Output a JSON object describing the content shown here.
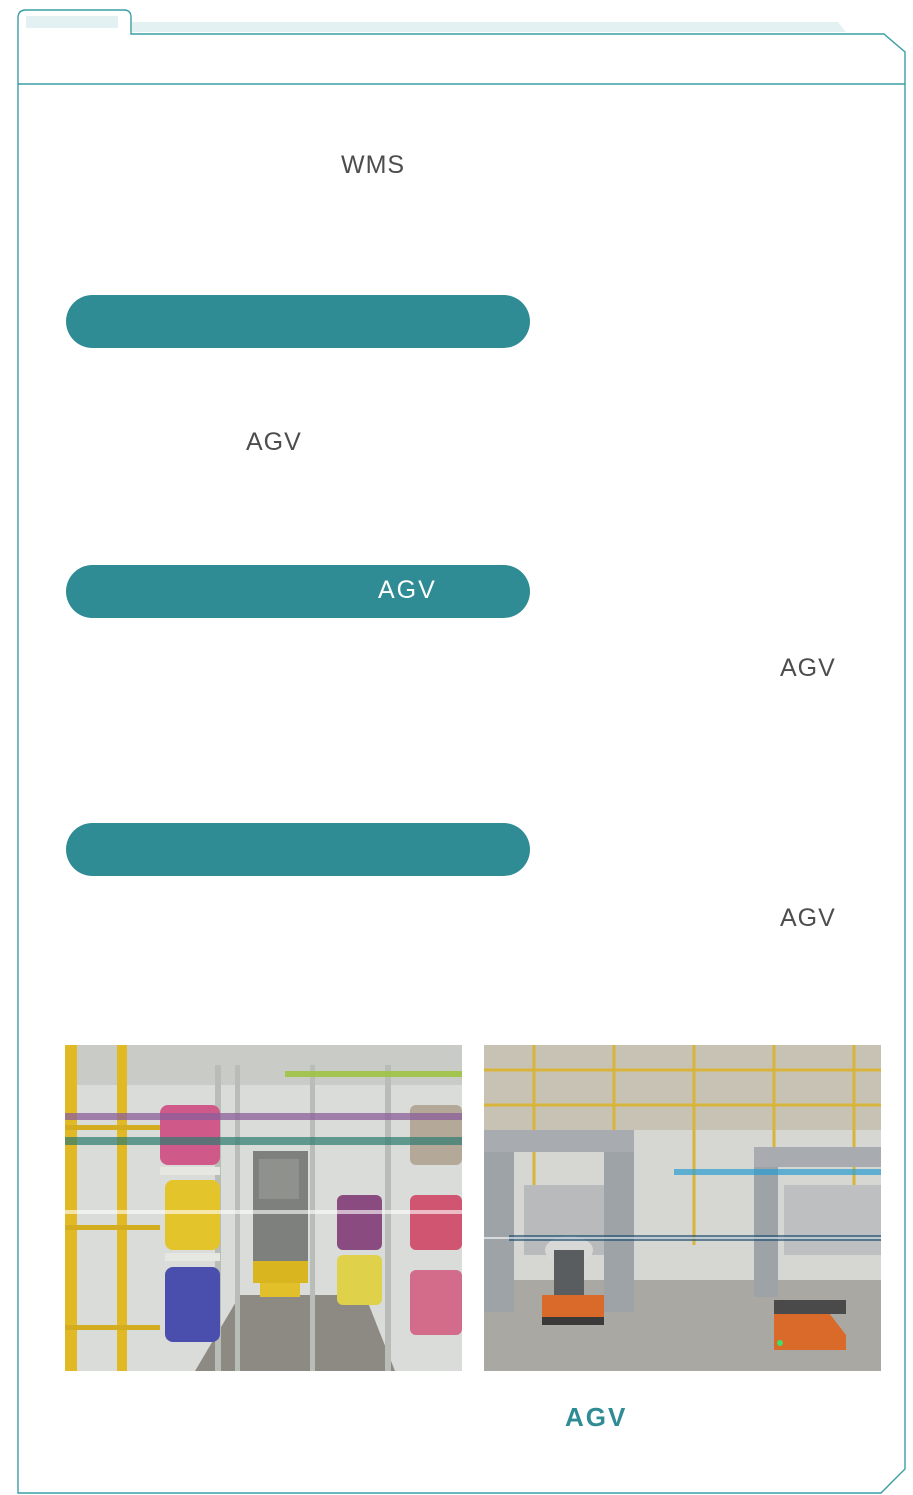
{
  "intro": {
    "wms_text": "WMS"
  },
  "section_1": {
    "heading": "",
    "body_agv": "AGV"
  },
  "section_2": {
    "heading_agv": "AGV",
    "body_agv": "AGV"
  },
  "section_3": {
    "heading": "",
    "body_agv": "AGV"
  },
  "figure": {
    "caption": "AGV"
  },
  "colors": {
    "accent": "#2f8c94",
    "frame": "#3a9ea5",
    "tab": "#e4f1f2",
    "text": "#4d4d4d"
  }
}
